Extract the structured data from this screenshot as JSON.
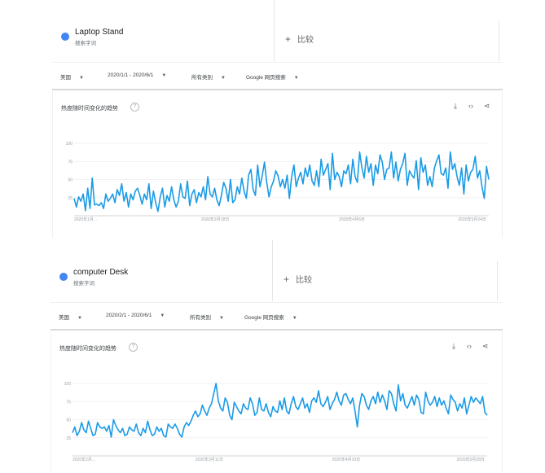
{
  "panels": [
    {
      "term": {
        "name": "Laptop Stand",
        "subtitle": "搜索字词",
        "color": "#4285f4"
      },
      "compare": {
        "plus": "+",
        "label": "比较"
      },
      "filters": [
        {
          "label": "美国"
        },
        {
          "label": "2020/1/1 - 2020/6/1"
        },
        {
          "label": "所有类别"
        },
        {
          "label": "Google 网页搜索"
        }
      ],
      "card": {
        "title": "热度随时间变化的趋势",
        "help_icon": "help-circle-icon",
        "tools": [
          "download-icon",
          "embed-code-icon",
          "share-icon"
        ]
      }
    },
    {
      "term": {
        "name": "computer Desk",
        "subtitle": "搜索字词",
        "color": "#4285f4"
      },
      "compare": {
        "plus": "+",
        "label": "比较"
      },
      "filters": [
        {
          "label": "美国"
        },
        {
          "label": "2020/2/1 - 2020/6/1"
        },
        {
          "label": "所有类别"
        },
        {
          "label": "Google 网页搜索"
        }
      ],
      "card": {
        "title": "热度随时间变化的趋势",
        "help_icon": "help-circle-icon",
        "tools": [
          "download-icon",
          "embed-code-icon",
          "share-icon"
        ]
      }
    }
  ],
  "chart_data": [
    {
      "type": "line",
      "title": "",
      "line_color": "#1a9be6",
      "ylim": [
        0,
        100
      ],
      "y_ticks": [
        25,
        50,
        75,
        100
      ],
      "x_tick_labels": [
        "2020年1月...",
        "2020年2月18日",
        "2020年4月6日",
        "2020年5月24日"
      ],
      "x_tick_fracs": [
        0.0,
        0.34,
        0.67,
        0.96
      ],
      "values": [
        24,
        12,
        26,
        20,
        30,
        7,
        38,
        10,
        52,
        15,
        16,
        14,
        18,
        10,
        30,
        20,
        24,
        30,
        18,
        36,
        28,
        44,
        20,
        32,
        12,
        30,
        22,
        34,
        38,
        28,
        16,
        30,
        22,
        44,
        10,
        34,
        18,
        6,
        26,
        38,
        12,
        28,
        20,
        40,
        22,
        12,
        20,
        44,
        26,
        24,
        48,
        14,
        30,
        36,
        18,
        32,
        26,
        40,
        22,
        54,
        30,
        26,
        38,
        22,
        14,
        28,
        46,
        38,
        20,
        50,
        18,
        22,
        40,
        30,
        52,
        34,
        24,
        56,
        64,
        36,
        28,
        70,
        40,
        55,
        74,
        46,
        26,
        40,
        48,
        62,
        55,
        40,
        50,
        38,
        56,
        24,
        54,
        70,
        40,
        52,
        60,
        44,
        66,
        54,
        70,
        48,
        42,
        62,
        40,
        78,
        56,
        64,
        72,
        36,
        86,
        50,
        60,
        54,
        40,
        62,
        58,
        70,
        44,
        78,
        54,
        46,
        88,
        66,
        52,
        82,
        60,
        72,
        42,
        70,
        58,
        84,
        74,
        50,
        64,
        66,
        88,
        52,
        74,
        48,
        64,
        72,
        86,
        42,
        62,
        56,
        52,
        76,
        36,
        80,
        60,
        70,
        42,
        54,
        40,
        66,
        76,
        84,
        58,
        56,
        66,
        38,
        88,
        64,
        72,
        54,
        42,
        66,
        30,
        70,
        48,
        60,
        64,
        82,
        52,
        62,
        40,
        24,
        68,
        50
      ],
      "series": [
        {
          "values": "same-as-above"
        }
      ]
    },
    {
      "type": "line",
      "title": "",
      "line_color": "#1a9be6",
      "ylim": [
        0,
        100
      ],
      "y_ticks": [
        25,
        50,
        75,
        100
      ],
      "x_tick_labels": [
        "2020年2月...",
        "2020年3月11日",
        "2020年4月19日",
        "2020年5月28日"
      ],
      "x_tick_fracs": [
        0.0,
        0.33,
        0.66,
        0.96
      ],
      "values": [
        32,
        40,
        28,
        34,
        46,
        36,
        32,
        48,
        38,
        28,
        30,
        46,
        40,
        38,
        40,
        34,
        42,
        26,
        50,
        42,
        36,
        32,
        38,
        28,
        30,
        40,
        36,
        34,
        44,
        32,
        28,
        38,
        32,
        48,
        36,
        28,
        30,
        40,
        34,
        38,
        28,
        26,
        44,
        40,
        38,
        44,
        38,
        30,
        26,
        40,
        46,
        42,
        48,
        56,
        62,
        54,
        58,
        70,
        62,
        56,
        66,
        72,
        86,
        100,
        76,
        66,
        62,
        80,
        74,
        56,
        50,
        74,
        68,
        62,
        58,
        72,
        66,
        64,
        80,
        72,
        56,
        60,
        80,
        64,
        62,
        72,
        60,
        54,
        68,
        62,
        60,
        76,
        64,
        80,
        62,
        58,
        72,
        82,
        68,
        64,
        72,
        80,
        66,
        72,
        60,
        76,
        80,
        74,
        90,
        72,
        68,
        74,
        82,
        64,
        72,
        78,
        88,
        76,
        70,
        84,
        86,
        78,
        72,
        80,
        62,
        40,
        70,
        86,
        82,
        70,
        64,
        76,
        82,
        72,
        88,
        74,
        84,
        76,
        64,
        90,
        86,
        72,
        62,
        98,
        76,
        86,
        70,
        66,
        74,
        82,
        70,
        84,
        78,
        60,
        58,
        88,
        76,
        70,
        74,
        82,
        68,
        80,
        70,
        76,
        66,
        58,
        84,
        78,
        74,
        62,
        72,
        66,
        80,
        58,
        70,
        82,
        74,
        80,
        76,
        72,
        82,
        60,
        56
      ]
    }
  ]
}
